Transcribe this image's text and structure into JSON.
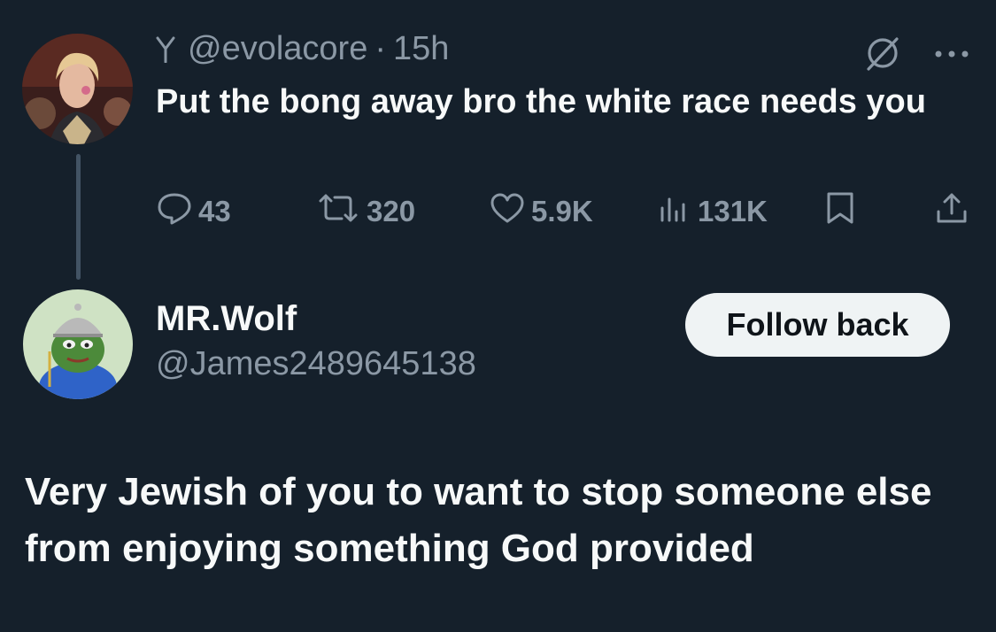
{
  "colors": {
    "background": "#15202b",
    "primary_text": "#f7f9f9",
    "secondary_text": "#8b98a5",
    "thread_line": "#425364",
    "button_bg": "#eff3f4",
    "button_text": "#0f1419"
  },
  "parent_post": {
    "header_icon": "fork-icon",
    "handle": "@evolacore",
    "separator": "·",
    "time": "15h",
    "grok_icon": "grok-icon",
    "more_icon": "more-icon",
    "text": "Put the bong away bro the white race needs you",
    "actions": {
      "replies": "43",
      "reposts": "320",
      "likes": "5.9K",
      "views": "131K"
    }
  },
  "reply": {
    "name": "MR.Wolf",
    "handle": "@James2489645138",
    "follow_label": "Follow back",
    "text": "Very Jewish of you to want to stop someone else from enjoying something God provided"
  }
}
